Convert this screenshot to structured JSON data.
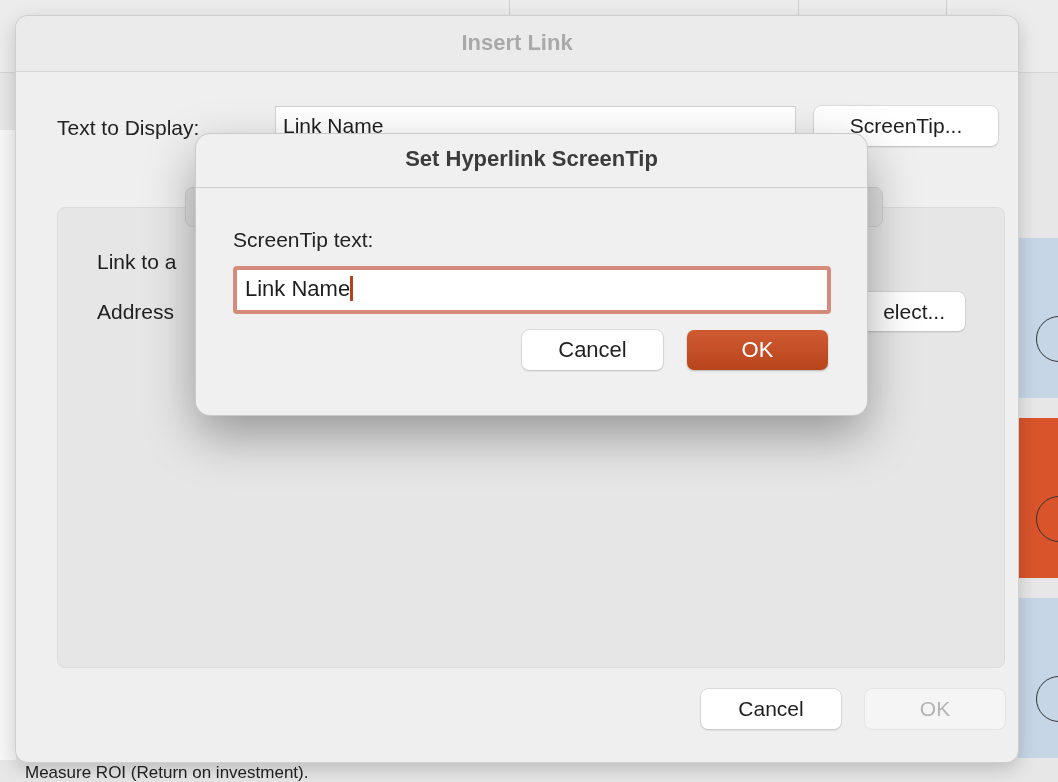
{
  "background_app": {
    "thumbnails": [
      {
        "color": "#c7d6e6"
      },
      {
        "color": "#d9542b"
      },
      {
        "color": "#c7d6e6"
      }
    ],
    "bullet": "Measure ROI (Return on investment)."
  },
  "insert_link": {
    "title": "Insert Link",
    "text_to_display_label": "Text to Display:",
    "text_to_display_value": "Link Name",
    "screentip_button": "ScreenTip...",
    "link_label": "Link to a",
    "address_label": "Address",
    "select_button": "elect...",
    "buttons": [
      {
        "label": "Cancel",
        "disabled": false
      },
      {
        "label": "OK",
        "disabled": true
      }
    ]
  },
  "screentip_sheet": {
    "title": "Set Hyperlink ScreenTip",
    "label": "ScreenTip text:",
    "value": "Link Name",
    "buttons": [
      {
        "label": "Cancel",
        "default": false
      },
      {
        "label": "OK",
        "default": true
      }
    ]
  }
}
